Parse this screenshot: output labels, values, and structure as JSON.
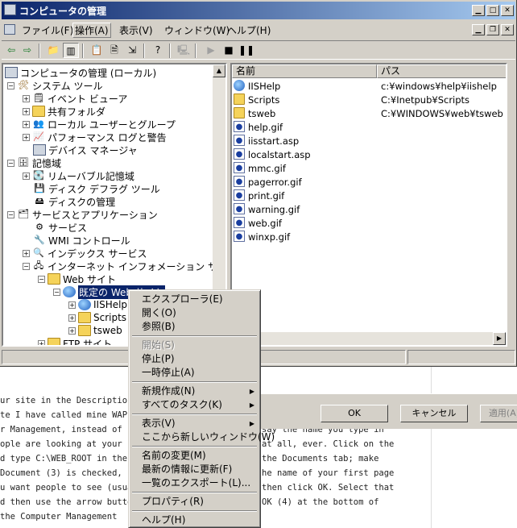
{
  "window": {
    "title": "コンピュータの管理",
    "menu": [
      "ファイル(F)",
      "操作(A)",
      "表示(V)",
      "ウィンドウ(W)",
      "ヘルプ(H)"
    ]
  },
  "tree": {
    "items": [
      {
        "label": "コンピュータの管理 (ローカル)"
      },
      {
        "label": "システム ツール"
      },
      {
        "label": "イベント ビューア"
      },
      {
        "label": "共有フォルダ"
      },
      {
        "label": "ローカル ユーザーとグループ"
      },
      {
        "label": "パフォーマンス ログと警告"
      },
      {
        "label": "デバイス マネージャ"
      },
      {
        "label": "記憶域"
      },
      {
        "label": "リムーバブル記憶域"
      },
      {
        "label": "ディスク デフラグ ツール"
      },
      {
        "label": "ディスクの管理"
      },
      {
        "label": "サービスとアプリケーション"
      },
      {
        "label": "サービス"
      },
      {
        "label": "WMI コントロール"
      },
      {
        "label": "インデックス サービス"
      },
      {
        "label": "インターネット インフォメーション サービス"
      },
      {
        "label": "Web サイト"
      },
      {
        "label": "既定の Web サイト"
      },
      {
        "label": "IISHelp"
      },
      {
        "label": "Scripts"
      },
      {
        "label": "tsweb"
      },
      {
        "label": "FTP サイト"
      }
    ]
  },
  "list": {
    "col_name": "名前",
    "col_path": "パス",
    "rows": [
      {
        "name": "IISHelp",
        "path": "c:¥windows¥help¥iishelp"
      },
      {
        "name": "Scripts",
        "path": "C:¥Inetpub¥Scripts"
      },
      {
        "name": "tsweb",
        "path": "C:¥WINDOWS¥web¥tsweb"
      },
      {
        "name": "help.gif",
        "path": ""
      },
      {
        "name": "iisstart.asp",
        "path": ""
      },
      {
        "name": "localstart.asp",
        "path": ""
      },
      {
        "name": "mmc.gif",
        "path": ""
      },
      {
        "name": "pagerror.gif",
        "path": ""
      },
      {
        "name": "print.gif",
        "path": ""
      },
      {
        "name": "warning.gif",
        "path": ""
      },
      {
        "name": "web.gif",
        "path": ""
      },
      {
        "name": "winxp.gif",
        "path": ""
      }
    ]
  },
  "context_menu": {
    "items": [
      "エクスプローラ(E)",
      "開く(O)",
      "参照(B)",
      "開始(S)",
      "停止(P)",
      "一時停止(A)",
      "新規作成(N)",
      "すべてのタスク(K)",
      "表示(V)",
      "ここから新しいウィンドウ(W)",
      "名前の変更(M)",
      "最新の情報に更新(F)",
      "一覧のエクスポート(L)...",
      "プロパティ(R)",
      "ヘルプ(H)"
    ]
  },
  "dialog": {
    "ok": "OK",
    "cancel": "キャンセル",
    "apply": "適用(A)"
  },
  "article": {
    "lines_left": [
      "ur site in the Description bo",
      "te I have called mine WAP",
      "r Management, instead of s",
      "ople are looking at your site",
      "d type C:\\WEB_ROOT in the",
      " Document (3) is checked, .",
      "u want people to see (usual",
      "d then use the arrow buttons",
      "the Computer Management"
    ],
    "lines_right": [
      "say the name you type in",
      "at all, ever. Click on the",
      "the Documents tab; make",
      "he name of your first page",
      "then click OK. Select that",
      "OK (4) at the bottom of"
    ]
  }
}
